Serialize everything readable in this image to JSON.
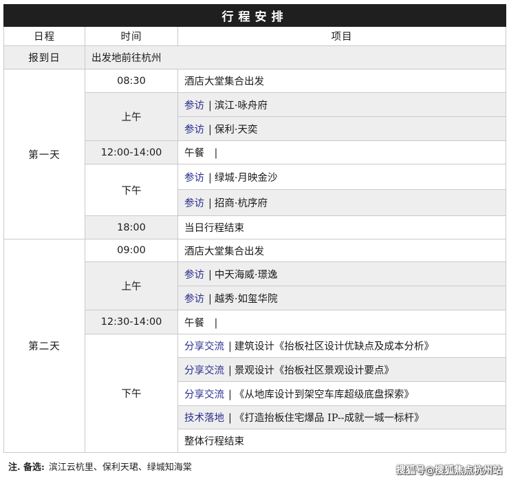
{
  "title": "行程安排",
  "headers": {
    "day": "日程",
    "time": "时间",
    "item": "项目"
  },
  "checkin": {
    "day": "报到日",
    "text": "出发地前往杭州"
  },
  "day1": {
    "label": "第一天",
    "rows": [
      {
        "time": "08:30",
        "text": "酒店大堂集合出发"
      },
      {
        "time": "上午",
        "tag": "参访",
        "text": "滨江·咏舟府"
      },
      {
        "tag": "参访",
        "text": "保利·天奕"
      },
      {
        "time": "12:00-14:00",
        "text": "午餐　|"
      },
      {
        "time": "下午",
        "tag": "参访",
        "text": "绿城·月映金沙"
      },
      {
        "tag": "参访",
        "text": "招商·杭序府"
      },
      {
        "time": "18:00",
        "text": "当日行程结束"
      }
    ]
  },
  "day2": {
    "label": "第二天",
    "rows": [
      {
        "time": "09:00",
        "text": "酒店大堂集合出发"
      },
      {
        "time": "上午",
        "tag": "参访",
        "text": "中天海威·璟逸"
      },
      {
        "tag": "参访",
        "text": "越秀·如玺华院"
      },
      {
        "time": "12:30-14:00",
        "text": "午餐　|"
      },
      {
        "time": "下午",
        "tag": "分享交流",
        "text": "建筑设计《抬板社区设计优缺点及成本分析》"
      },
      {
        "tag": "分享交流",
        "text": "景观设计《抬板社区景观设计要点》"
      },
      {
        "tag": "分享交流",
        "text": "《从地库设计到架空车库超级底盘探索》"
      },
      {
        "tag": "技术落地",
        "text": "《打造抬板住宅爆品 IP--成就一城一标杆》"
      },
      {
        "text": "整体行程结束"
      }
    ]
  },
  "note": {
    "label": "注. 备选:",
    "text": "滨江云杭里、保利天珺、绿城知海棠"
  },
  "watermark": "搜狐号@搜狐焦点杭州站",
  "separator": "|"
}
